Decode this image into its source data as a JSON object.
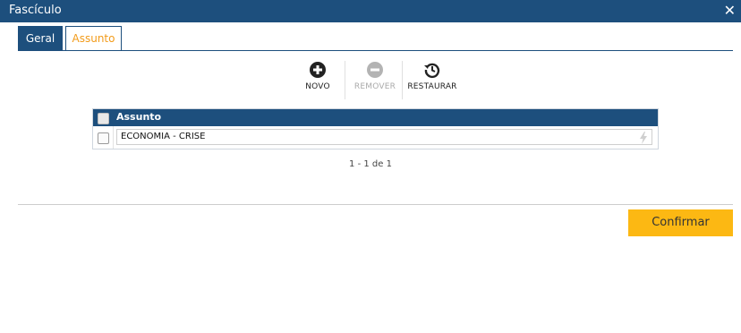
{
  "window": {
    "title": "Fascículo",
    "close_icon": "close-icon"
  },
  "tabs": [
    {
      "label": "Geral",
      "active": false
    },
    {
      "label": "Assunto",
      "active": true
    }
  ],
  "toolbar": {
    "novo": {
      "label": "NOVO",
      "icon": "plus-circle-icon",
      "enabled": true
    },
    "remover": {
      "label": "REMOVER",
      "icon": "minus-circle-icon",
      "enabled": false
    },
    "restaurar": {
      "label": "RESTAURAR",
      "icon": "restore-history-icon",
      "enabled": true
    }
  },
  "grid": {
    "column_header": "Assunto",
    "rows": [
      {
        "value": "ECONOMIA - CRISE",
        "checked": false
      }
    ]
  },
  "pager": {
    "text": "1 - 1 de 1"
  },
  "footer": {
    "confirm_label": "Confirmar"
  },
  "colors": {
    "primary": "#1d4f7d",
    "accent": "#f29b1a",
    "button": "#fcb813"
  }
}
